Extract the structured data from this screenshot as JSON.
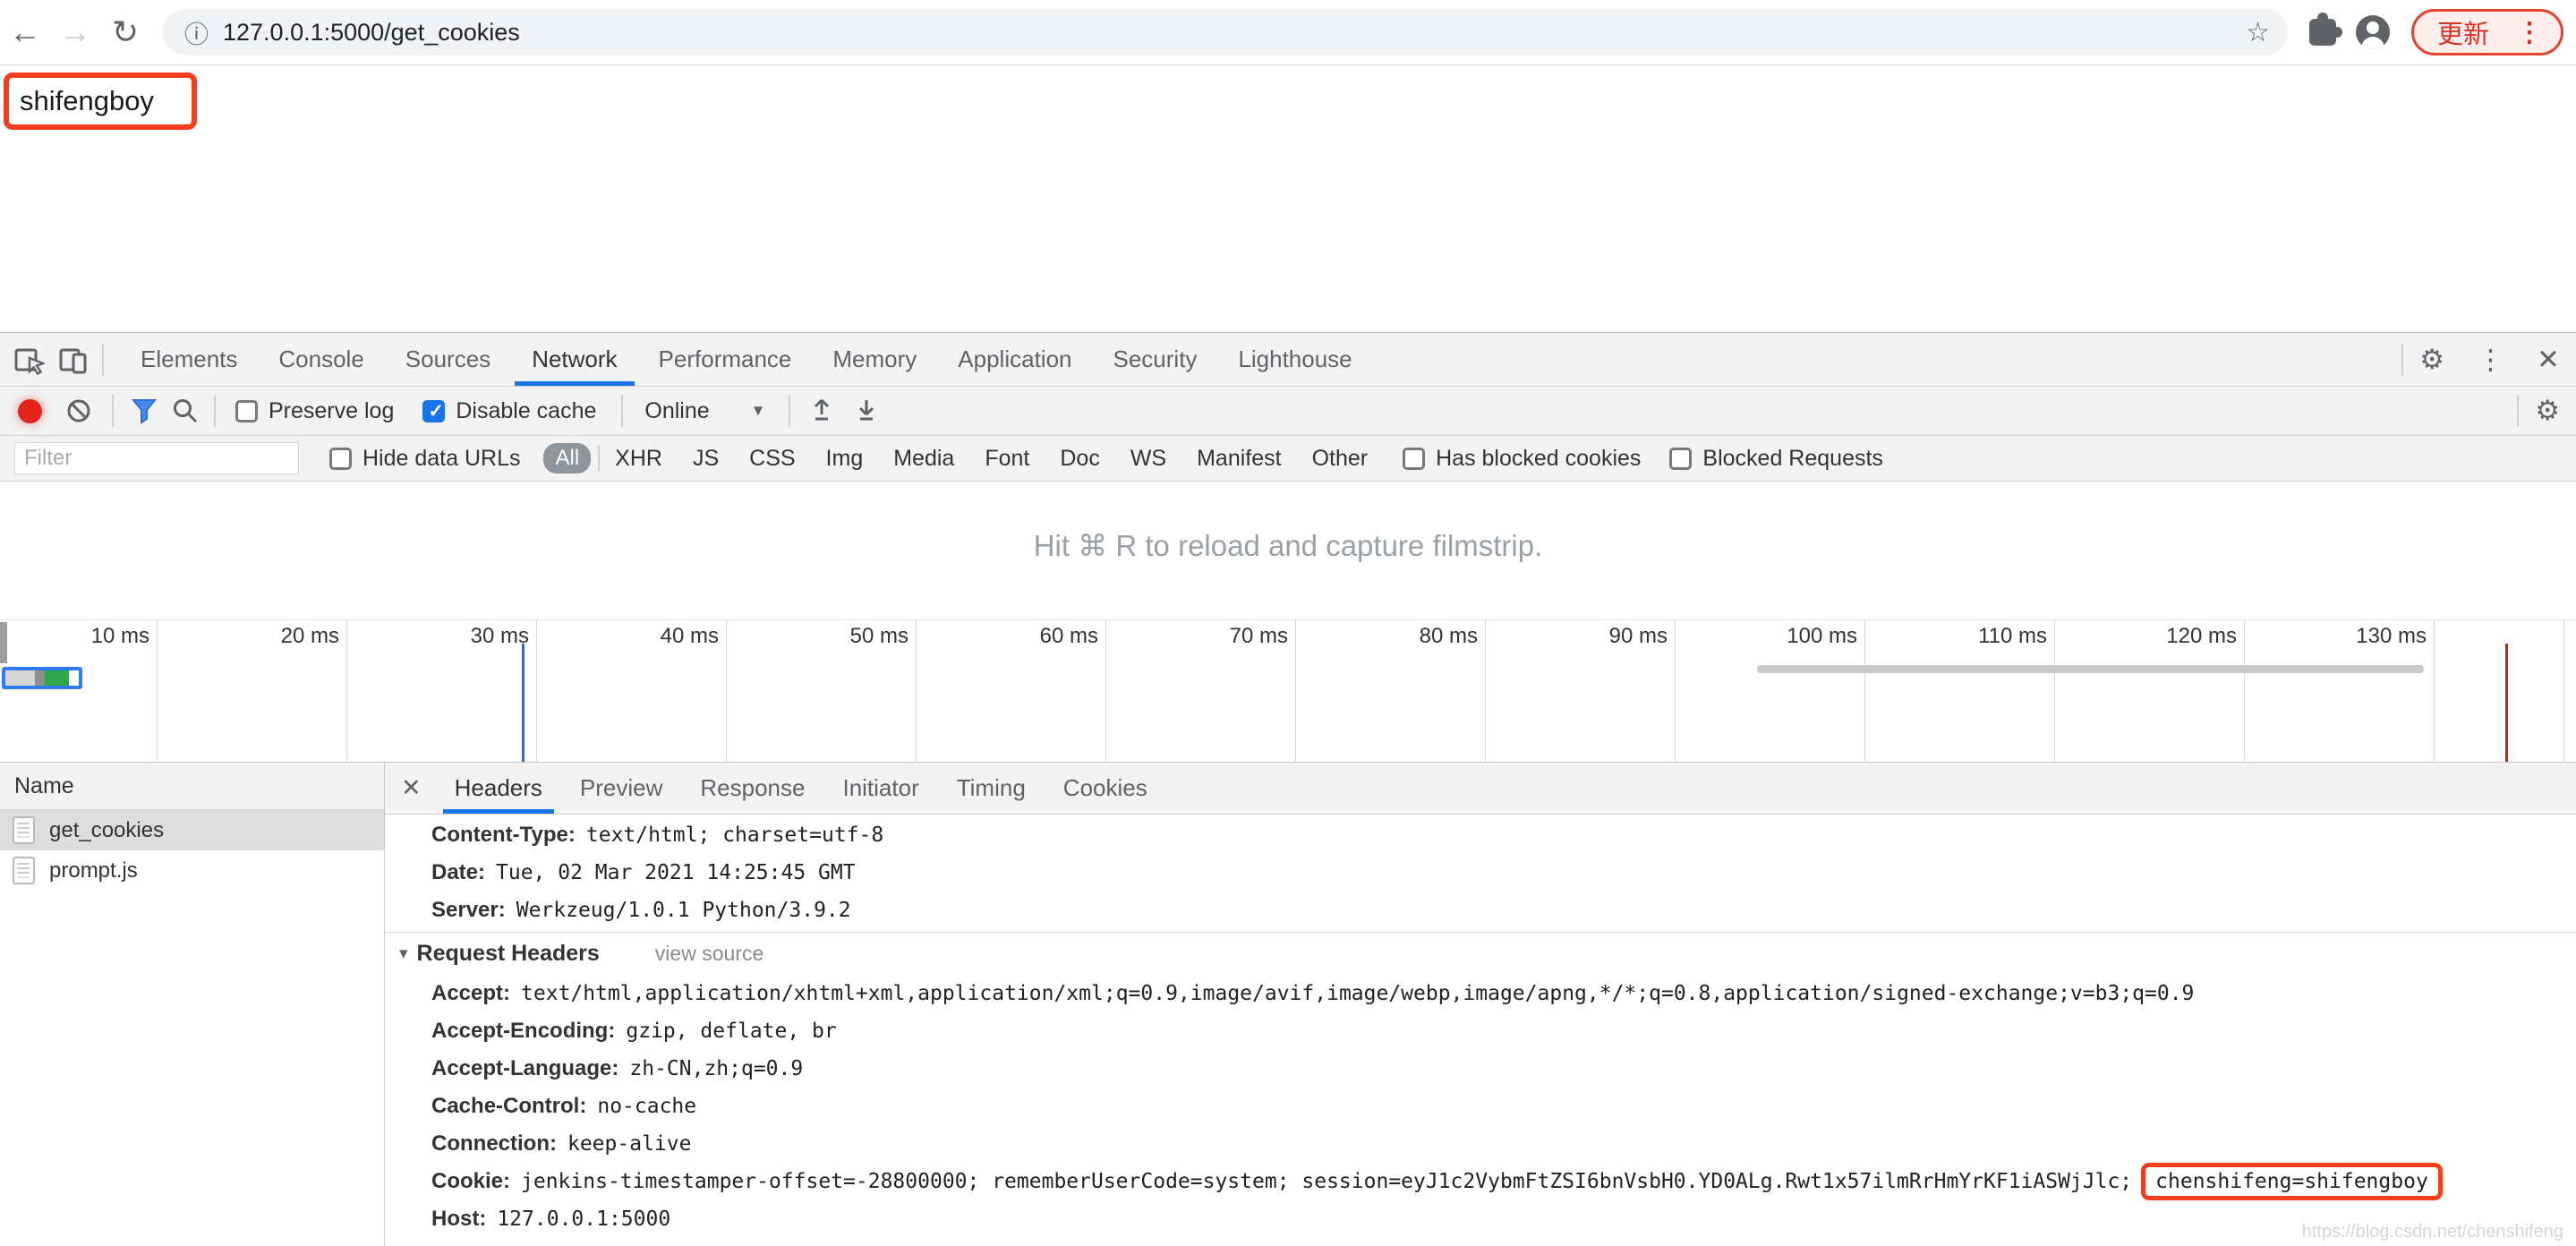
{
  "browser": {
    "url": "127.0.0.1:5000/get_cookies",
    "update_button": "更新"
  },
  "icons": {
    "back": "←",
    "forward": "→",
    "reload": "↻",
    "info": "ⓘ",
    "star": "☆",
    "menu": "⋮",
    "close": "✕",
    "settings": "⚙",
    "collapse": "▾",
    "dropdown": "▼"
  },
  "page": {
    "content": "shifengboy"
  },
  "watermark": "https://blog.csdn.net/chenshifeng",
  "devtools": {
    "main_tabs": [
      "Elements",
      "Console",
      "Sources",
      "Network",
      "Performance",
      "Memory",
      "Application",
      "Security",
      "Lighthouse"
    ],
    "active_main_tab": "Network",
    "toolbar": {
      "preserve_log": "Preserve log",
      "disable_cache": "Disable cache",
      "throttling": "Online"
    },
    "filter_bar": {
      "placeholder": "Filter",
      "hide_data_urls": "Hide data URLs",
      "types": [
        "All",
        "XHR",
        "JS",
        "CSS",
        "Img",
        "Media",
        "Font",
        "Doc",
        "WS",
        "Manifest",
        "Other"
      ],
      "active_type": "All",
      "has_blocked_cookies": "Has blocked cookies",
      "blocked_requests": "Blocked Requests"
    },
    "hint": "Hit ⌘ R to reload and capture filmstrip.",
    "timeline": {
      "ticks": [
        "10 ms",
        "20 ms",
        "30 ms",
        "40 ms",
        "50 ms",
        "60 ms",
        "70 ms",
        "80 ms",
        "90 ms",
        "100 ms",
        "110 ms",
        "120 ms",
        "130 ms"
      ]
    },
    "requests": {
      "column": "Name",
      "rows": [
        {
          "name": "get_cookies",
          "selected": true
        },
        {
          "name": "prompt.js",
          "selected": false
        }
      ]
    },
    "detail": {
      "tabs": [
        "Headers",
        "Preview",
        "Response",
        "Initiator",
        "Timing",
        "Cookies"
      ],
      "active_tab": "Headers",
      "response_headers": [
        {
          "name": "Content-Type:",
          "value": "text/html; charset=utf-8"
        },
        {
          "name": "Date:",
          "value": "Tue, 02 Mar 2021 14:25:45 GMT"
        },
        {
          "name": "Server:",
          "value": "Werkzeug/1.0.1 Python/3.9.2"
        }
      ],
      "request_headers_title": "Request Headers",
      "view_source": "view source",
      "request_headers": [
        {
          "name": "Accept:",
          "value": "text/html,application/xhtml+xml,application/xml;q=0.9,image/avif,image/webp,image/apng,*/*;q=0.8,application/signed-exchange;v=b3;q=0.9"
        },
        {
          "name": "Accept-Encoding:",
          "value": "gzip, deflate, br"
        },
        {
          "name": "Accept-Language:",
          "value": "zh-CN,zh;q=0.9"
        },
        {
          "name": "Cache-Control:",
          "value": "no-cache"
        },
        {
          "name": "Connection:",
          "value": "keep-alive"
        },
        {
          "name": "Cookie:",
          "value": "jenkins-timestamper-offset=-28800000; rememberUserCode=system; session=eyJ1c2VybmFtZSI6bnVsbH0.YD0ALg.Rwt1x57ilmRrHmYrKF1iASWjJlc;",
          "highlight": "chenshifeng=shifengboy"
        },
        {
          "name": "Host:",
          "value": "127.0.0.1:5000"
        }
      ]
    }
  }
}
